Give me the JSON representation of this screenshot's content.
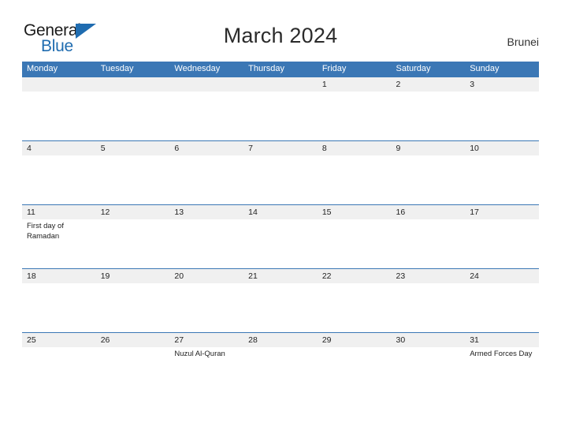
{
  "brand": {
    "word1": "General",
    "word2": "Blue",
    "triangle_color": "#1f6cb0",
    "text_color": "#1b1b1b"
  },
  "header": {
    "title": "March 2024",
    "location": "Brunei"
  },
  "theme": {
    "header_blue": "#3b77b5",
    "date_band_gray": "#f0f0f0",
    "separator_blue": "#3b77b5",
    "page_background": "#ffffff"
  },
  "calendar": {
    "day_names": [
      "Monday",
      "Tuesday",
      "Wednesday",
      "Thursday",
      "Friday",
      "Saturday",
      "Sunday"
    ],
    "weeks": [
      {
        "dates": [
          "",
          "",
          "",
          "",
          "1",
          "2",
          "3"
        ],
        "events": [
          "",
          "",
          "",
          "",
          "",
          "",
          ""
        ]
      },
      {
        "dates": [
          "4",
          "5",
          "6",
          "7",
          "8",
          "9",
          "10"
        ],
        "events": [
          "",
          "",
          "",
          "",
          "",
          "",
          ""
        ]
      },
      {
        "dates": [
          "11",
          "12",
          "13",
          "14",
          "15",
          "16",
          "17"
        ],
        "events": [
          "First day of Ramadan",
          "",
          "",
          "",
          "",
          "",
          ""
        ]
      },
      {
        "dates": [
          "18",
          "19",
          "20",
          "21",
          "22",
          "23",
          "24"
        ],
        "events": [
          "",
          "",
          "",
          "",
          "",
          "",
          ""
        ]
      },
      {
        "dates": [
          "25",
          "26",
          "27",
          "28",
          "29",
          "30",
          "31"
        ],
        "events": [
          "",
          "",
          "Nuzul Al-Quran",
          "",
          "",
          "",
          "Armed Forces Day"
        ]
      }
    ]
  }
}
